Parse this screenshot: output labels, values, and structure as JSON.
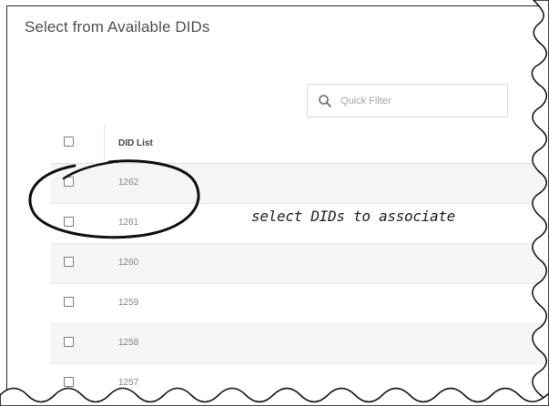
{
  "panel": {
    "title": "Select from Available DIDs"
  },
  "filter": {
    "placeholder": "Quick Filter",
    "value": ""
  },
  "table": {
    "header": "DID List",
    "rows": [
      {
        "label": "1262"
      },
      {
        "label": "1261"
      },
      {
        "label": "1260"
      },
      {
        "label": "1259"
      },
      {
        "label": "1258"
      },
      {
        "label": "1257"
      }
    ]
  },
  "annotation": {
    "text": "select DIDs to associate"
  },
  "icons": {
    "filter": "search-icon",
    "checkbox": "checkbox-icon"
  },
  "colors": {
    "title": "#505050",
    "row_alt": "#f5f5f5",
    "text": "#858585",
    "annotation": "#222222"
  }
}
